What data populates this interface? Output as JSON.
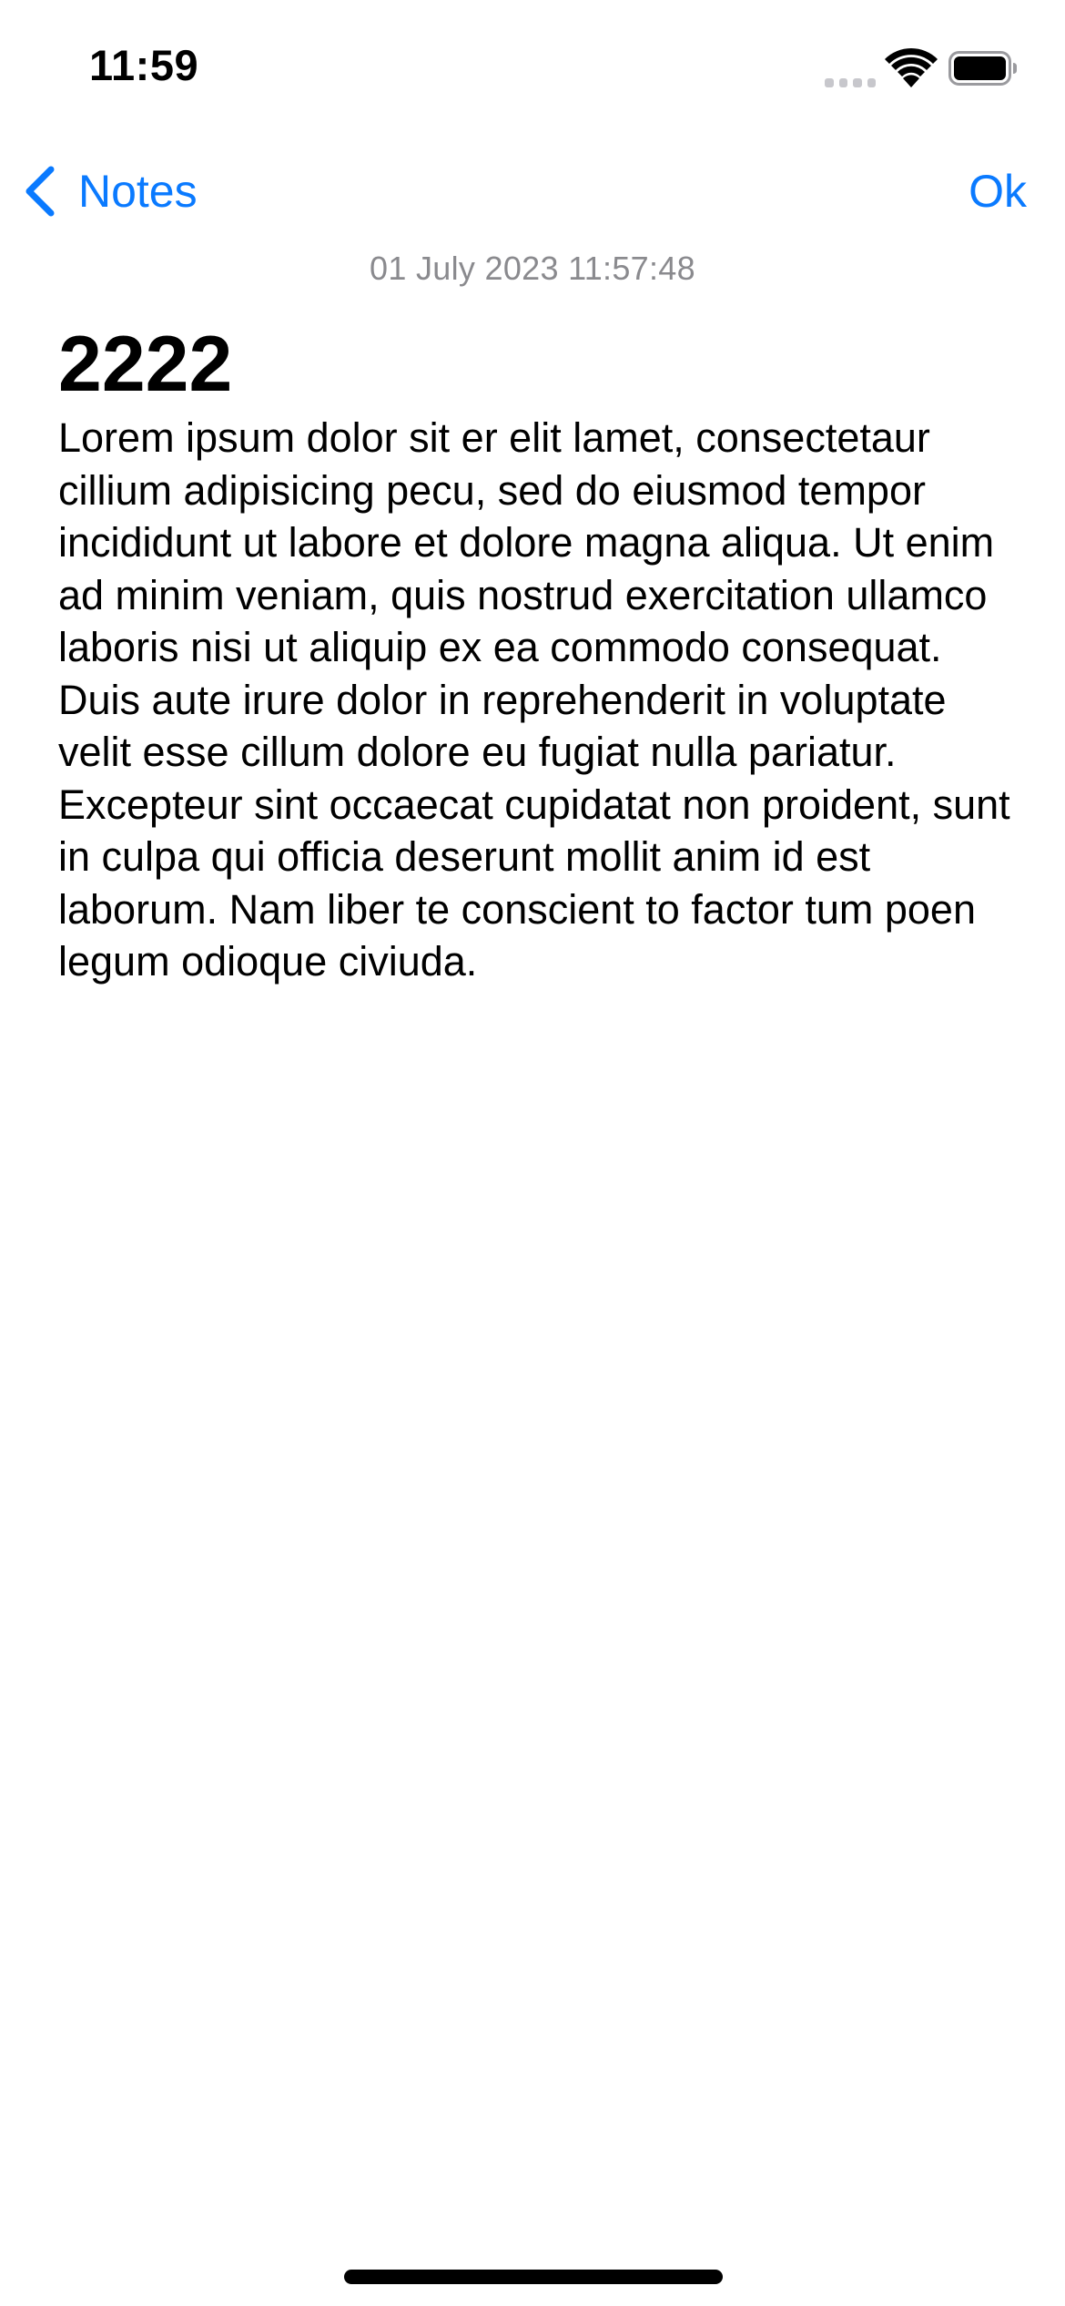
{
  "status_bar": {
    "time": "11:59",
    "icons": [
      "cellular-signal-icon",
      "wifi-icon",
      "battery-icon"
    ]
  },
  "nav": {
    "back_label": "Notes",
    "back_icon": "chevron-left-icon",
    "ok_label": "Ok",
    "accent_color": "#0a7aff"
  },
  "note": {
    "timestamp": "01 July 2023 11:57:48",
    "title": "2222",
    "body": "Lorem ipsum dolor sit er elit lamet, consectetaur cillium adipisicing pecu, sed do eiusmod tempor incididunt ut labore et dolore magna aliqua. Ut enim ad minim veniam, quis nostrud exercitation ullamco laboris nisi ut aliquip ex ea commodo consequat. Duis aute irure dolor in reprehenderit in voluptate velit esse cillum dolore eu fugiat nulla pariatur. Excepteur sint occaecat cupidatat non proident, sunt in culpa qui officia deserunt mollit anim id est laborum. Nam liber te conscient to factor tum poen legum odioque civiuda."
  }
}
